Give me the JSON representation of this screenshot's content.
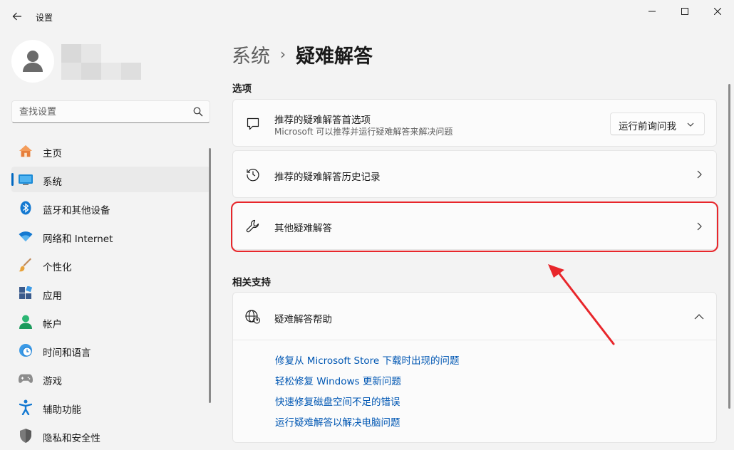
{
  "window": {
    "title": "设置"
  },
  "sidebar": {
    "search_placeholder": "查找设置",
    "items": [
      {
        "label": "主页",
        "icon": "home-icon"
      },
      {
        "label": "系统",
        "icon": "system-icon",
        "active": true
      },
      {
        "label": "蓝牙和其他设备",
        "icon": "bluetooth-icon"
      },
      {
        "label": "网络和 Internet",
        "icon": "wifi-icon"
      },
      {
        "label": "个性化",
        "icon": "brush-icon"
      },
      {
        "label": "应用",
        "icon": "apps-icon"
      },
      {
        "label": "帐户",
        "icon": "account-icon"
      },
      {
        "label": "时间和语言",
        "icon": "clock-globe-icon"
      },
      {
        "label": "游戏",
        "icon": "gamepad-icon"
      },
      {
        "label": "辅助功能",
        "icon": "accessibility-icon"
      },
      {
        "label": "隐私和安全性",
        "icon": "shield-icon"
      }
    ]
  },
  "breadcrumb": {
    "parent": "系统",
    "separator": "›",
    "current": "疑难解答"
  },
  "options_section": {
    "title": "选项",
    "recommended_prefs": {
      "title": "推荐的疑难解答首选项",
      "subtitle": "Microsoft 可以推荐并运行疑难解答来解决问题",
      "dropdown_value": "运行前询问我"
    },
    "history": {
      "title": "推荐的疑难解答历史记录"
    },
    "other": {
      "title": "其他疑难解答"
    }
  },
  "support_section": {
    "title": "相关支持",
    "help": {
      "title": "疑难解答帮助",
      "links": [
        "修复从 Microsoft Store 下载时出现的问题",
        "轻松修复 Windows 更新问题",
        "快速修复磁盘空间不足的错误",
        "运行疑难解答以解决电脑问题"
      ]
    }
  },
  "colors": {
    "accent": "#0067c0",
    "link": "#0057b3",
    "annotation": "#e8262b"
  }
}
